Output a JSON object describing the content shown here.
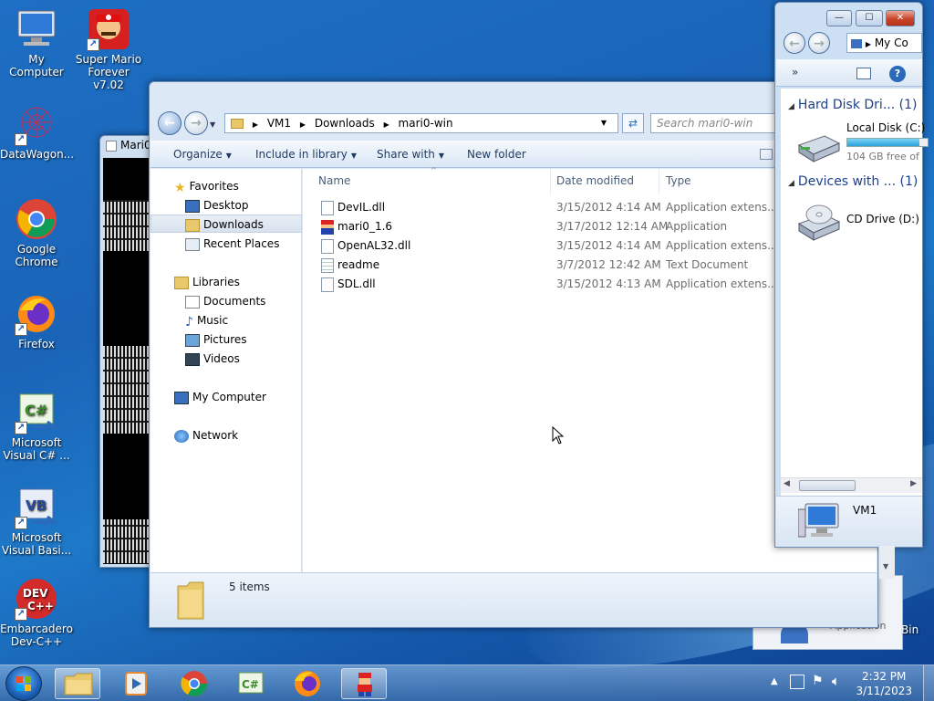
{
  "desktop": {
    "icons": [
      {
        "label": "My Computer"
      },
      {
        "label": "Super Mario Forever v7.02"
      },
      {
        "label": "DataWagon..."
      },
      {
        "label": "Google Chrome"
      },
      {
        "label": "Firefox"
      },
      {
        "label": "Microsoft Visual C# ..."
      },
      {
        "label": "Microsoft Visual Basi..."
      },
      {
        "label": "Embarcadero Dev-C++"
      }
    ],
    "partial_labels": {
      "application": "Application",
      "bin": "Bin"
    }
  },
  "mario_window": {
    "title": "Mari0"
  },
  "explorer": {
    "breadcrumb": [
      "VM1",
      "Downloads",
      "mari0-win"
    ],
    "search_placeholder": "Search mari0-win",
    "toolbar": {
      "organize": "Organize",
      "include": "Include in library",
      "share": "Share with",
      "new_folder": "New folder"
    },
    "nav": {
      "favorites": "Favorites",
      "desktop": "Desktop",
      "downloads": "Downloads",
      "recent": "Recent Places",
      "libraries": "Libraries",
      "documents": "Documents",
      "music": "Music",
      "pictures": "Pictures",
      "videos": "Videos",
      "my_computer": "My Computer",
      "network": "Network"
    },
    "columns": {
      "name": "Name",
      "date": "Date modified",
      "type": "Type"
    },
    "files": [
      {
        "name": "DevIL.dll",
        "date": "3/15/2012 4:14 AM",
        "type": "Application extens..."
      },
      {
        "name": "mari0_1.6",
        "date": "3/17/2012 12:14 AM",
        "type": "Application"
      },
      {
        "name": "OpenAL32.dll",
        "date": "3/15/2012 4:14 AM",
        "type": "Application extens..."
      },
      {
        "name": "readme",
        "date": "3/7/2012 12:42 AM",
        "type": "Text Document"
      },
      {
        "name": "SDL.dll",
        "date": "3/15/2012 4:13 AM",
        "type": "Application extens..."
      }
    ],
    "status": "5 items"
  },
  "computer_window": {
    "address": "My Co",
    "hdd_group": "Hard Disk Dri... (1)",
    "drive_name": "Local Disk (C:)",
    "drive_free": "104 GB free of",
    "drive_fill_fraction": 0.9,
    "devices_group": "Devices with ... (1)",
    "cd_drive": "CD Drive (D:)",
    "footer_name": "VM1"
  },
  "taskbar": {
    "time": "2:32 PM",
    "date": "3/11/2023"
  },
  "colors": {
    "accent": "#1e3f8c",
    "drive_bar": "#3cb1e6"
  }
}
